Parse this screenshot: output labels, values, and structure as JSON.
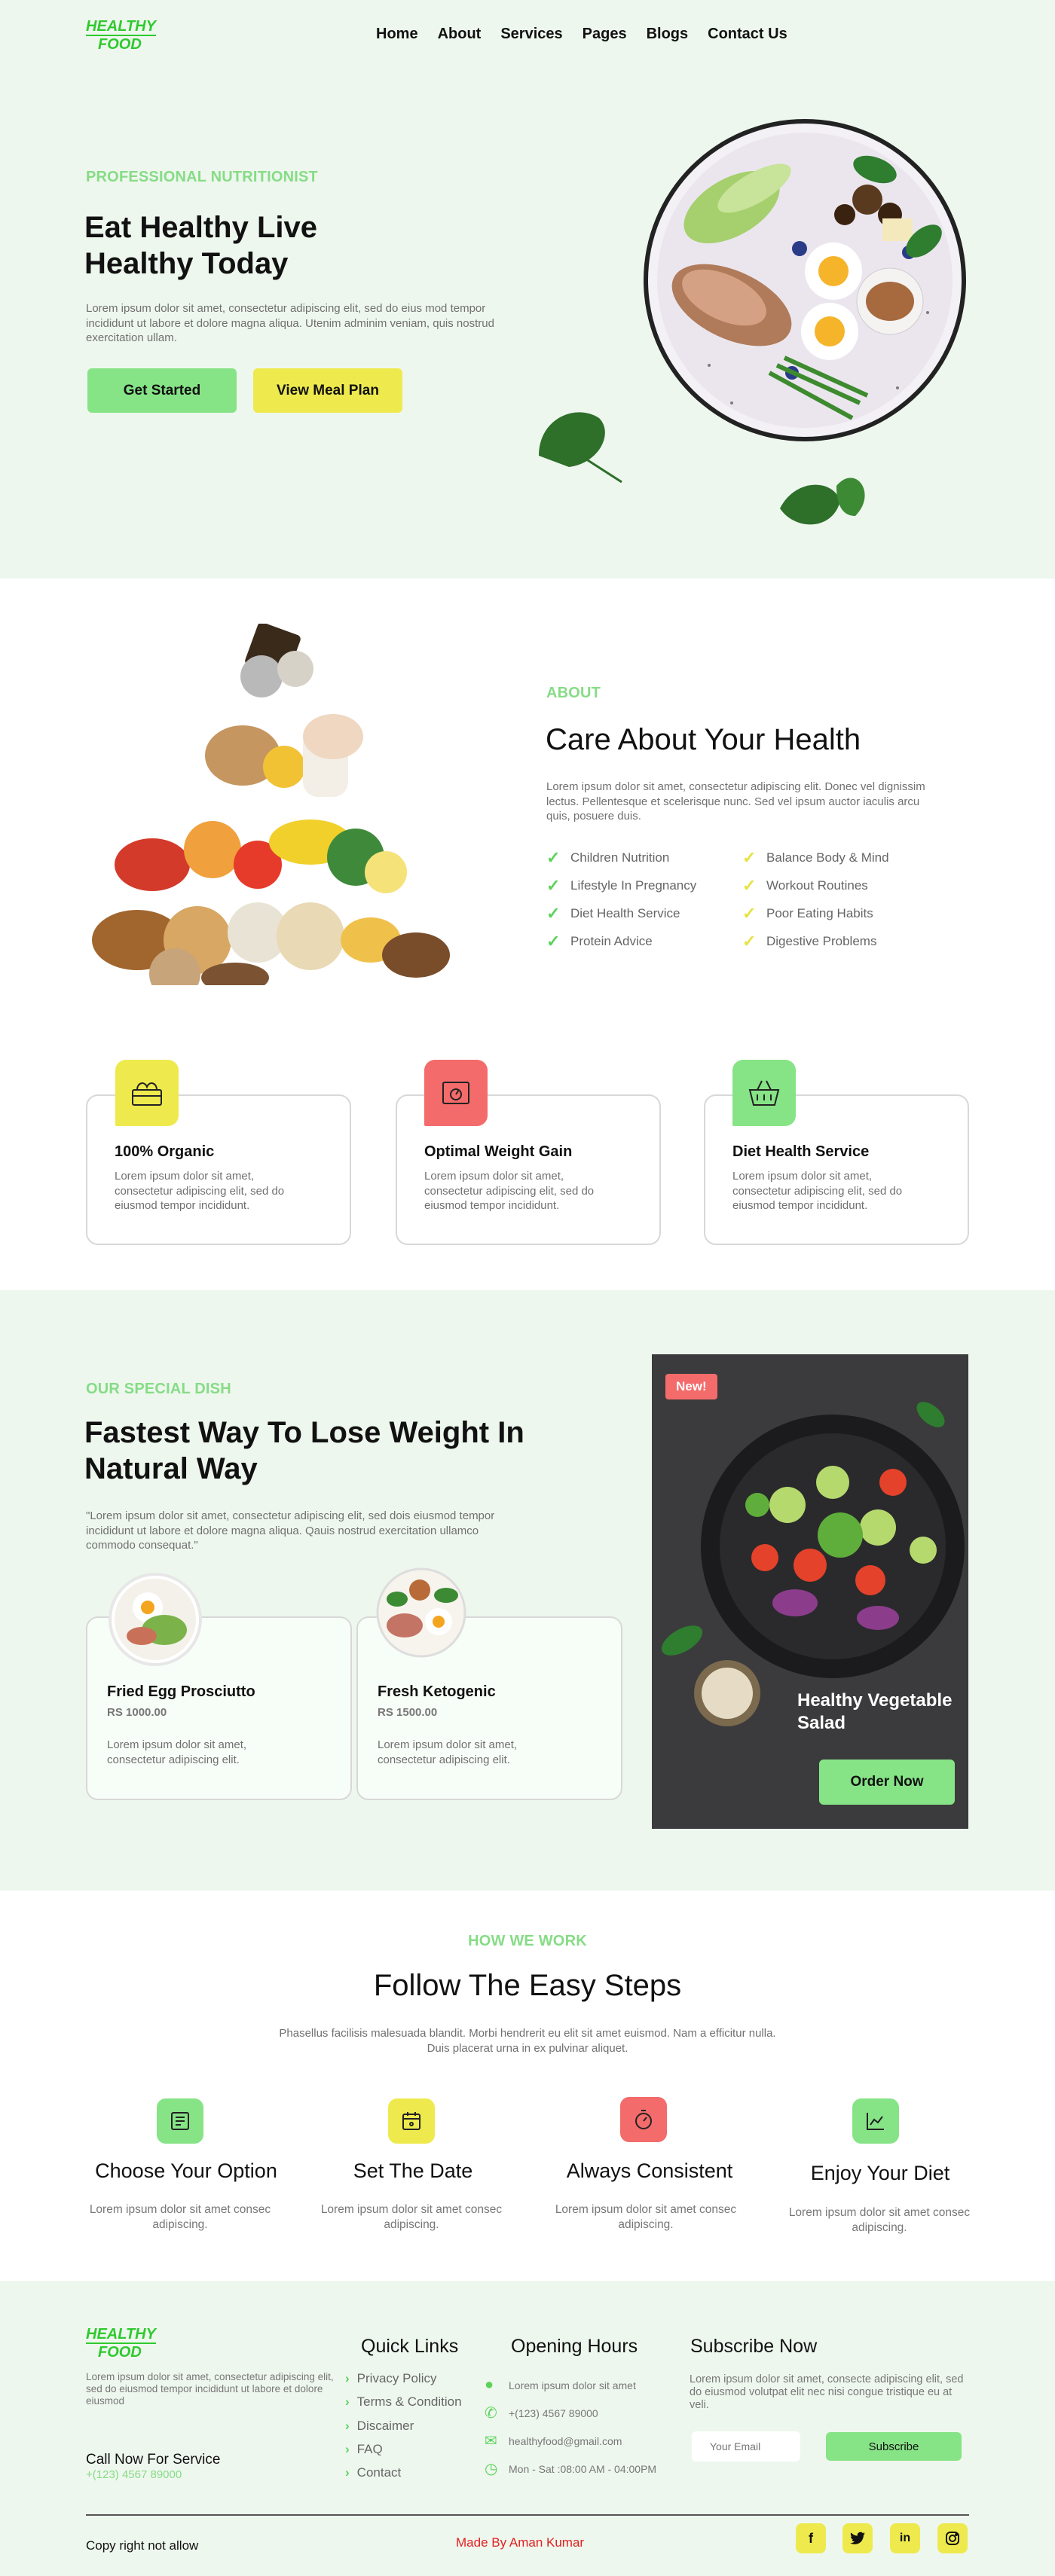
{
  "brand": {
    "line1": "HEALTHY",
    "line2": "FOOD"
  },
  "nav": [
    "Home",
    "About",
    "Services",
    "Pages",
    "Blogs",
    "Contact Us"
  ],
  "hero": {
    "kicker": "PROFESSIONAL NUTRITIONIST",
    "title_line1": "Eat Healthy Live",
    "title_line2": "Healthy Today",
    "text": "Lorem ipsum dolor sit amet, consectetur adipiscing elit, sed do eius mod tempor incididunt ut labore et dolore magna aliqua. Utenim adminim veniam, quis nostrud exercitation ullam.",
    "btn_primary": "Get Started",
    "btn_secondary": "View Meal Plan"
  },
  "about": {
    "kicker": "ABOUT",
    "title": "Care About Your Health",
    "text": "Lorem ipsum dolor sit amet, consectetur adipiscing elit. Donec vel dignissim lectus. Pellentesque et scelerisque nunc. Sed vel ipsum auctor iaculis arcu quis, posuere duis.",
    "features_left": [
      "Children Nutrition",
      "Lifestyle In Pregnancy",
      "Diet Health Service",
      "Protein Advice"
    ],
    "features_right": [
      "Balance Body & Mind",
      "Workout Routines",
      "Poor Eating Habits",
      "Digestive Problems"
    ]
  },
  "services": [
    {
      "title": "100% Organic",
      "text": "Lorem ipsum dolor sit amet, consectetur adipiscing elit, sed do eiusmod tempor incididunt.",
      "icon": "crate-icon",
      "color": "#eeea4e"
    },
    {
      "title": "Optimal Weight Gain",
      "text": "Lorem ipsum dolor sit amet, consectetur adipiscing elit, sed do eiusmod tempor incididunt.",
      "icon": "scale-icon",
      "color": "#f36b6b"
    },
    {
      "title": "Diet Health Service",
      "text": "Lorem ipsum dolor sit amet, consectetur adipiscing elit, sed do eiusmod tempor incididunt.",
      "icon": "basket-icon",
      "color": "#86e486"
    }
  ],
  "special": {
    "kicker": "OUR SPECIAL DISH",
    "title_line1": "Fastest Way To Lose Weight In",
    "title_line2": "Natural Way",
    "text": "\"Lorem ipsum dolor sit amet, consectetur adipiscing elit, sed dois eiusmod tempor incididunt ut labore et dolore magna aliqua. Qauis nostrud exercitation ullamco  commodo consequat.\"",
    "dishes": [
      {
        "name": "Fried Egg Prosciutto",
        "price": "RS 1000.00",
        "text": "Lorem ipsum dolor sit amet, consectetur adipiscing elit."
      },
      {
        "name": "Fresh Ketogenic",
        "price": "RS 1500.00",
        "text": "Lorem ipsum dolor sit amet, consectetur adipiscing elit."
      }
    ],
    "promo_badge": "New!",
    "promo_title_line1": "Healthy Vegetable",
    "promo_title_line2": "Salad",
    "promo_button": "Order Now"
  },
  "how": {
    "kicker": "HOW WE WORK",
    "title": "Follow The Easy Steps",
    "text_line1": "Phasellus facilisis malesuada blandit. Morbi hendrerit eu elit sit amet euismod. Nam a efficitur nulla.",
    "text_line2": "Duis placerat urna in ex pulvinar aliquet.",
    "steps": [
      {
        "title": "Choose Your Option",
        "text": "Lorem ipsum dolor sit amet consec adipiscing.",
        "icon": "menu-card-icon",
        "color": "#86e486"
      },
      {
        "title": "Set The Date",
        "text": "Lorem ipsum dolor sit amet consec adipiscing.",
        "icon": "calendar-icon",
        "color": "#eeea4e"
      },
      {
        "title": "Always Consistent",
        "text": "Lorem ipsum dolor sit amet consec adipiscing.",
        "icon": "stopwatch-icon",
        "color": "#f36b6b"
      },
      {
        "title": "Enjoy Your Diet",
        "text": "Lorem ipsum dolor sit amet consec adipiscing.",
        "icon": "chart-icon",
        "color": "#86e486"
      }
    ]
  },
  "footer": {
    "about": "Lorem ipsum dolor sit amet, consectetur adipiscing elit, sed do eiusmod tempor incididunt ut labore et dolore eiusmod",
    "call_label": "Call Now For Service",
    "call_number": "+(123) 4567 89000",
    "quick_links_title": "Quick Links",
    "quick_links": [
      "Privacy Policy",
      "Terms & Condition",
      "Discaimer",
      "FAQ",
      "Contact"
    ],
    "opening_title": "Opening Hours",
    "opening": [
      {
        "icon": "location-icon",
        "text": "Lorem ipsum dolor sit amet"
      },
      {
        "icon": "phone-icon",
        "text": "+(123) 4567 89000"
      },
      {
        "icon": "mail-icon",
        "text": "healthyfood@gmail.com"
      },
      {
        "icon": "clock-icon",
        "text": "Mon - Sat :08:00 AM - 04:00PM"
      }
    ],
    "subscribe_title": "Subscribe  Now",
    "subscribe_text": "Lorem ipsum dolor sit amet, consecte adipiscing elit, sed do eiusmod volutpat elit nec nisi congue tristique eu at veli.",
    "email_placeholder": "Your Email",
    "subscribe_button": "Subscribe",
    "copyright": "Copy right not allow",
    "made_by": "Made By Aman Kumar",
    "social": [
      "f",
      "t",
      "in",
      "o"
    ]
  },
  "colors": {
    "green": "#86e486",
    "yellow": "#eeea4e",
    "red": "#f36b6b",
    "bg": "#eef7ee"
  }
}
